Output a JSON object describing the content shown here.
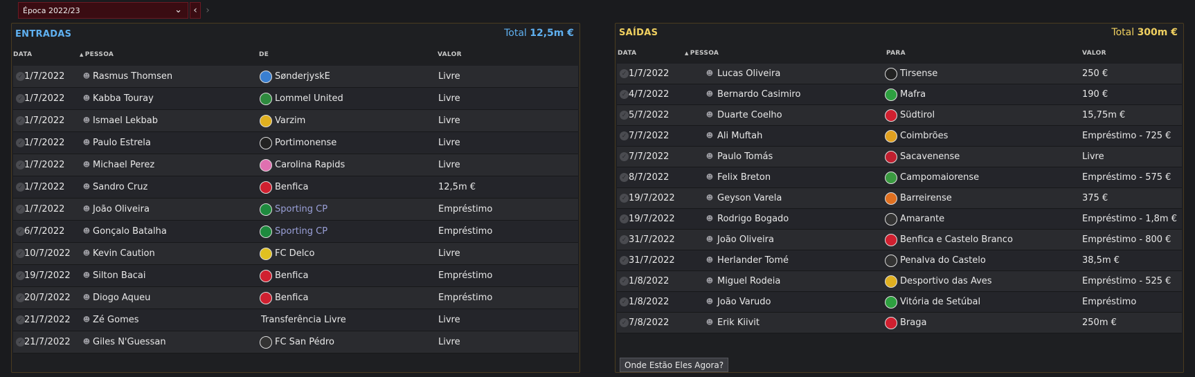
{
  "season": {
    "label": "Época 2022/23",
    "prev_icon": "chevron-left-icon",
    "next_icon": "chevron-right-icon"
  },
  "entradas": {
    "title": "ENTRADAS",
    "total_label": "Total",
    "total_value": "12,5m €",
    "accent": "#5fb0f0",
    "headers": {
      "date": "DATA",
      "person": "PESSOA",
      "from": "DE",
      "value": "VALOR"
    },
    "rows": [
      {
        "date": "1/7/2022",
        "person": "Rasmus Thomsen",
        "club": "SønderjyskE",
        "value": "Livre",
        "badge": "#3a7fd0"
      },
      {
        "date": "1/7/2022",
        "person": "Kabba Touray",
        "club": "Lommel United",
        "value": "Livre",
        "badge": "#2e8a3e"
      },
      {
        "date": "1/7/2022",
        "person": "Ismael Lekbab",
        "club": "Varzim",
        "value": "Livre",
        "badge": "#e0b020"
      },
      {
        "date": "1/7/2022",
        "person": "Paulo Estrela",
        "club": "Portimonense",
        "value": "Livre",
        "badge": "#222222"
      },
      {
        "date": "1/7/2022",
        "person": "Michael Perez",
        "club": "Carolina Rapids",
        "value": "Livre",
        "badge": "#e070b0"
      },
      {
        "date": "1/7/2022",
        "person": "Sandro Cruz",
        "club": "Benfica",
        "value": "12,5m €",
        "badge": "#d02030"
      },
      {
        "date": "1/7/2022",
        "person": "João Oliveira",
        "club": "Sporting CP",
        "value": "Empréstimo",
        "badge": "#1e8a3e",
        "muted": true
      },
      {
        "date": "6/7/2022",
        "person": "Gonçalo Batalha",
        "club": "Sporting CP",
        "value": "Empréstimo",
        "badge": "#1e8a3e",
        "muted": true
      },
      {
        "date": "10/7/2022",
        "person": "Kevin Caution",
        "club": "FC Delco",
        "value": "Livre",
        "badge": "#e0c020"
      },
      {
        "date": "19/7/2022",
        "person": "Silton Bacai",
        "club": "Benfica",
        "value": "Empréstimo",
        "badge": "#d02030"
      },
      {
        "date": "20/7/2022",
        "person": "Diogo Aqueu",
        "club": "Benfica",
        "value": "Empréstimo",
        "badge": "#d02030"
      },
      {
        "date": "21/7/2022",
        "person": "Zé Gomes",
        "club": "Transferência Livre",
        "value": "Livre",
        "badge": ""
      },
      {
        "date": "21/7/2022",
        "person": "Giles N'Guessan",
        "club": "FC San Pédro",
        "value": "Livre",
        "badge": "#333333"
      }
    ]
  },
  "saidas": {
    "title": "SAÍDAS",
    "total_label": "Total",
    "total_value": "300m €",
    "accent": "#f0d060",
    "headers": {
      "date": "DATA",
      "person": "PESSOA",
      "to": "PARA",
      "value": "VALOR"
    },
    "rows": [
      {
        "date": "1/7/2022",
        "person": "Lucas Oliveira",
        "club": "Tirsense",
        "value": "250 €",
        "badge": "#222222"
      },
      {
        "date": "4/7/2022",
        "person": "Bernardo Casimiro",
        "club": "Mafra",
        "value": "190 €",
        "badge": "#2ea040"
      },
      {
        "date": "5/7/2022",
        "person": "Duarte Coelho",
        "club": "Südtirol",
        "value": "15,75m €",
        "badge": "#d02030"
      },
      {
        "date": "7/7/2022",
        "person": "Ali Muftah",
        "club": "Coimbrões",
        "value": "Empréstimo - 725 €",
        "badge": "#e0a020"
      },
      {
        "date": "7/7/2022",
        "person": "Paulo Tomás",
        "club": "Sacavenense",
        "value": "Livre",
        "badge": "#c02030"
      },
      {
        "date": "8/7/2022",
        "person": "Felix Breton",
        "club": "Campomaiorense",
        "value": "Empréstimo - 575 €",
        "badge": "#3a9a40"
      },
      {
        "date": "19/7/2022",
        "person": "Geyson Varela",
        "club": "Barreirense",
        "value": "375 €",
        "badge": "#e07020"
      },
      {
        "date": "19/7/2022",
        "person": "Rodrigo Bogado",
        "club": "Amarante",
        "value": "Empréstimo - 1,8m €",
        "badge": "#333333"
      },
      {
        "date": "31/7/2022",
        "person": "João Oliveira",
        "club": "Benfica e Castelo Branco",
        "value": "Empréstimo - 800 €",
        "badge": "#d02030"
      },
      {
        "date": "31/7/2022",
        "person": "Herlander Tomé",
        "club": "Penalva do Castelo",
        "value": "38,5m €",
        "badge": "#333333"
      },
      {
        "date": "1/8/2022",
        "person": "Miguel Rodeia",
        "club": "Desportivo das Aves",
        "value": "Empréstimo - 525 €",
        "badge": "#e0b020"
      },
      {
        "date": "1/8/2022",
        "person": "João Varudo",
        "club": "Vitória de Setúbal",
        "value": "Empréstimo",
        "badge": "#2ea040"
      },
      {
        "date": "7/8/2022",
        "person": "Erik Kiivit",
        "club": "Braga",
        "value": "250m €",
        "badge": "#d02030"
      }
    ],
    "where_button": "Onde Estão Eles Agora?"
  }
}
